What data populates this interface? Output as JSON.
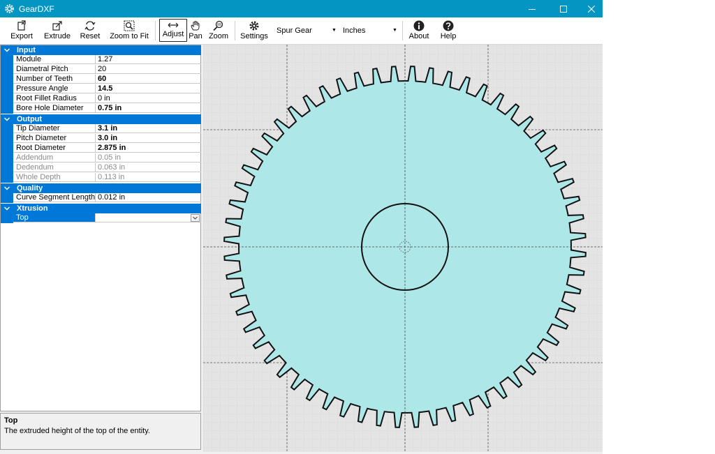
{
  "window": {
    "title": "GearDXF",
    "icons": {
      "app": "gear-app-icon",
      "minimize": "minimize-icon",
      "maximize": "maximize-icon",
      "close": "close-icon"
    }
  },
  "toolbar": {
    "export": "Export",
    "extrude": "Extrude",
    "reset": "Reset",
    "zoom_to_fit": "Zoom to Fit",
    "adjust": "Adjust",
    "pan": "Pan",
    "zoom": "Zoom",
    "settings": "Settings",
    "gear_type": "Spur Gear",
    "units": "Inches",
    "about": "About",
    "help": "Help"
  },
  "properties": {
    "input": {
      "label": "Input",
      "rows": [
        {
          "name": "Module",
          "value": "1.27"
        },
        {
          "name": "Diametral Pitch",
          "value": "20"
        },
        {
          "name": "Number of Teeth",
          "value": "60"
        },
        {
          "name": "Pressure Angle",
          "value": "14.5"
        },
        {
          "name": "Root Fillet Radius",
          "value": "0 in"
        },
        {
          "name": "Bore Hole Diameter",
          "value": "0.75 in"
        }
      ]
    },
    "output": {
      "label": "Output",
      "rows": [
        {
          "name": "Tip Diameter",
          "value": "3.1 in"
        },
        {
          "name": "Pitch Diameter",
          "value": "3.0 in"
        },
        {
          "name": "Root Diameter",
          "value": "2.875 in"
        },
        {
          "name": "Addendum",
          "value": "0.05 in"
        },
        {
          "name": "Dedendum",
          "value": "0.063 in"
        },
        {
          "name": "Whole Depth",
          "value": "0.113 in"
        }
      ]
    },
    "quality": {
      "label": "Quality",
      "rows": [
        {
          "name": "Curve Segment Length",
          "value": "0.012 in"
        }
      ]
    },
    "xtrusion": {
      "label": "Xtrusion",
      "rows": [
        {
          "name": "Top",
          "value": ""
        }
      ]
    }
  },
  "help_panel": {
    "title": "Top",
    "description": "The extruded height of the top of the entity."
  },
  "colors": {
    "titlebar": "#0496c2",
    "category": "#0078d7",
    "gear_fill": "#aee7e7",
    "grid_bg": "#e4e4e4"
  }
}
